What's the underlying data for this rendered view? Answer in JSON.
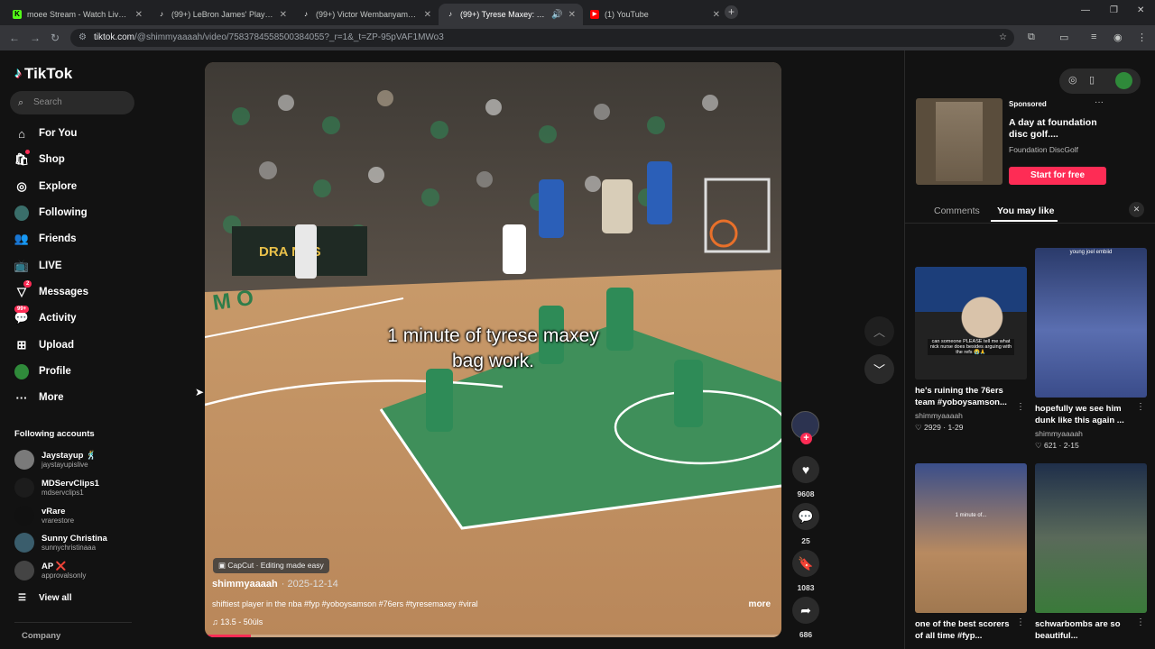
{
  "browser": {
    "tabs": [
      {
        "title": "moee Stream - Watch Live on K",
        "favicon": "K",
        "color": "#53fc18"
      },
      {
        "title": "(99+) LeBron James' Playoff Hig",
        "favicon": "♪",
        "color": "#000000"
      },
      {
        "title": "(99+) Victor Wembanyama: The",
        "favicon": "♪",
        "color": "#000000"
      },
      {
        "title": "(99+) Tyrese Maxey: The Sh",
        "favicon": "♪",
        "color": "#000000"
      },
      {
        "title": "(1) YouTube",
        "favicon": "▶",
        "color": "#ff0000"
      }
    ],
    "url_host": "tiktok.com",
    "url_path": "/@shimmyaaaah/video/7583784558500384055?_r=1&_t=ZP-95pVAF1MWo3"
  },
  "sidebar": {
    "logo": "TikTok",
    "search_placeholder": "Search",
    "nav": [
      {
        "label": "For You",
        "icon": "home-icon"
      },
      {
        "label": "Shop",
        "icon": "shop-icon"
      },
      {
        "label": "Explore",
        "icon": "compass-icon"
      },
      {
        "label": "Following",
        "icon": "following-icon"
      },
      {
        "label": "Friends",
        "icon": "friends-icon"
      },
      {
        "label": "LIVE",
        "icon": "live-icon"
      },
      {
        "label": "Messages",
        "icon": "messages-icon",
        "badge": "2"
      },
      {
        "label": "Activity",
        "icon": "activity-icon",
        "badge": "99+"
      },
      {
        "label": "Upload",
        "icon": "upload-icon"
      },
      {
        "label": "Profile",
        "icon": "profile-icon"
      },
      {
        "label": "More",
        "icon": "more-icon"
      }
    ],
    "following_title": "Following accounts",
    "accounts": [
      {
        "name": "Jaystayup 🕺",
        "handle": "jaystayupislive"
      },
      {
        "name": "MDServClips1",
        "handle": "mdservclips1"
      },
      {
        "name": "vRare",
        "handle": "vrarestore"
      },
      {
        "name": "Sunny Christina",
        "handle": "sunnychristinaaa"
      },
      {
        "name": "AP ❌",
        "handle": "approvalsonly"
      }
    ],
    "view_all": "View all",
    "company": "Company"
  },
  "video": {
    "overlay_line1": "1 minute of tyrese maxey",
    "overlay_line2": "bag work.",
    "capcut": "CapCut · Editing made easy",
    "author": "shimmyaaaah",
    "date": "· 2025-12-14",
    "caption": "shiftiest player in the nba #fyp #yoboysamson #76ers #tyresemaxey #viral",
    "more": "more",
    "sound": "♫  13.5 - 50üls",
    "progress": 0.08
  },
  "actions": {
    "likes": "9608",
    "comments": "25",
    "saves": "1083",
    "shares": "686"
  },
  "right_panel": {
    "ad": {
      "sponsored": "Sponsored",
      "title": "A day at foundation disc golf....",
      "brand": "Foundation DiscGolf",
      "cta": "Start for free"
    },
    "tabs": [
      "Comments",
      "You may like"
    ],
    "cards": [
      {
        "title": "he's ruining the 76ers team #yoboysamson...",
        "author": "shimmyaaaah",
        "stats": "♡ 2929 · 1-29",
        "thumb_text": "can someone PLEASE tell me what nick nurse does besides arguing with the refs 😭🙏"
      },
      {
        "title": "hopefully we see him dunk like this again ...",
        "author": "shimmyaaaah",
        "stats": "♡ 621 · 2-15",
        "thumb_text": "young joel embiid"
      },
      {
        "title": "one of the best scorers of all time #fyp...",
        "author": "",
        "stats": "",
        "thumb_text": "1 minute of..."
      },
      {
        "title": "schwarbombs are so beautiful...",
        "author": "",
        "stats": "",
        "thumb_text": ""
      }
    ]
  }
}
